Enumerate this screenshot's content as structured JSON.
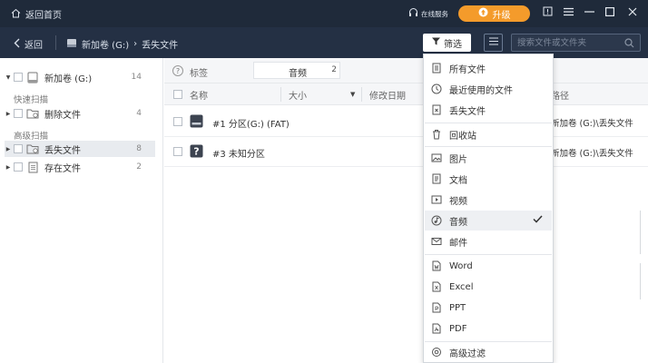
{
  "titlebar": {
    "home_label": "返回首页",
    "service_label": "在线服务",
    "upgrade_label": "升级"
  },
  "nav": {
    "back_label": "返回",
    "crumb_drive": "新加卷 (G:)",
    "crumb_sep": "›",
    "crumb_folder": "丢失文件",
    "filter_label": "筛选",
    "search_placeholder": "搜索文件或文件夹"
  },
  "sidebar": {
    "root": {
      "label": "新加卷 (G:)",
      "count": "14"
    },
    "quick_scan_label": "快速扫描",
    "quick_items": [
      {
        "label": "删除文件",
        "count": "4"
      }
    ],
    "deep_scan_label": "高级扫描",
    "deep_items": [
      {
        "label": "丢失文件",
        "count": "8"
      },
      {
        "label": "存在文件",
        "count": "2"
      }
    ]
  },
  "tagbar": {
    "label": "标签",
    "value": "音频",
    "count": "2"
  },
  "table": {
    "columns": {
      "name": "名称",
      "size": "大小",
      "modified": "修改日期",
      "path": "路径"
    },
    "rows": [
      {
        "name": "#1 分区(G:) (FAT)",
        "path": "新加卷 (G:)\\丢失文件"
      },
      {
        "name": "#3 未知分区",
        "path": "新加卷 (G:)\\丢失文件"
      }
    ]
  },
  "dropdown": {
    "items": [
      {
        "label": "所有文件",
        "icon": "all-files-icon"
      },
      {
        "label": "最近使用的文件",
        "icon": "clock-icon"
      },
      {
        "label": "丢失文件",
        "icon": "lost-file-icon"
      },
      {
        "label": "回收站",
        "icon": "recycle-bin-icon"
      },
      {
        "label": "图片",
        "icon": "image-icon"
      },
      {
        "label": "文档",
        "icon": "document-icon"
      },
      {
        "label": "视频",
        "icon": "video-icon"
      },
      {
        "label": "音频",
        "icon": "audio-icon",
        "selected": true
      },
      {
        "label": "邮件",
        "icon": "mail-icon"
      },
      {
        "label": "Word",
        "icon": "word-icon"
      },
      {
        "label": "Excel",
        "icon": "excel-icon"
      },
      {
        "label": "PPT",
        "icon": "ppt-icon"
      },
      {
        "label": "PDF",
        "icon": "pdf-icon"
      },
      {
        "label": "高级过滤",
        "icon": "advanced-filter-icon"
      }
    ]
  },
  "colors": {
    "titlebar_bg": "#1f2a3a",
    "navbar_bg": "#243044",
    "upgrade_bg": "#f49b2b"
  }
}
